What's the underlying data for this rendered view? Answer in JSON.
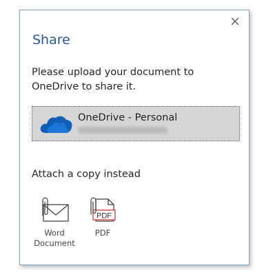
{
  "dialog": {
    "title": "Share",
    "description": "Please upload your document to OneDrive to share it.",
    "close_icon": "close-icon"
  },
  "onedrive": {
    "name": "OneDrive - Personal",
    "icon": "onedrive-cloud-icon",
    "cloud_color": "#0f5fb8"
  },
  "attach": {
    "heading": "Attach a copy instead",
    "items": [
      {
        "label_line1": "Word",
        "label_line2": "Document",
        "icon": "word-document-attachment-icon"
      },
      {
        "label_line1": "PDF",
        "icon": "pdf-attachment-icon",
        "badge": "PDF"
      }
    ]
  },
  "colors": {
    "title": "#2b579a",
    "selection_bg": "#d6d6d6",
    "pdf_red": "#d13438"
  }
}
